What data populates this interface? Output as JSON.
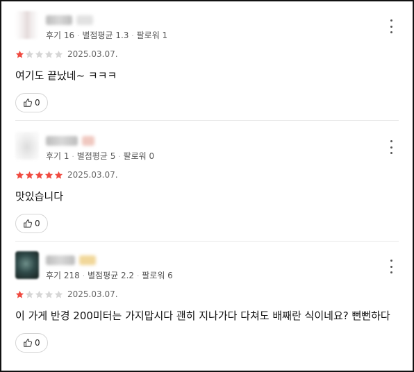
{
  "reviews": [
    {
      "stats": {
        "reviews": "후기 16",
        "avg": "별점평균 1.3",
        "followers": "팔로워 1"
      },
      "rating": 1,
      "date": "2025.03.07.",
      "text": "여기도 끝났네~ ㅋㅋㅋ",
      "likes": "0"
    },
    {
      "stats": {
        "reviews": "후기 1",
        "avg": "별점평균 5",
        "followers": "팔로워 0"
      },
      "rating": 5,
      "date": "2025.03.07.",
      "text": "맛있습니다",
      "likes": "0"
    },
    {
      "stats": {
        "reviews": "후기 218",
        "avg": "별점평균 2.2",
        "followers": "팔로워 6"
      },
      "rating": 1,
      "date": "2025.03.07.",
      "text": "이 가게 반경 200미터는 가지맙시다 괜히 지나가다 다쳐도 배째란 식이네요? 뻔뻔하다",
      "likes": "0"
    }
  ],
  "colors": {
    "star_on": "#f04a40",
    "star_off": "#d6d6d6"
  }
}
